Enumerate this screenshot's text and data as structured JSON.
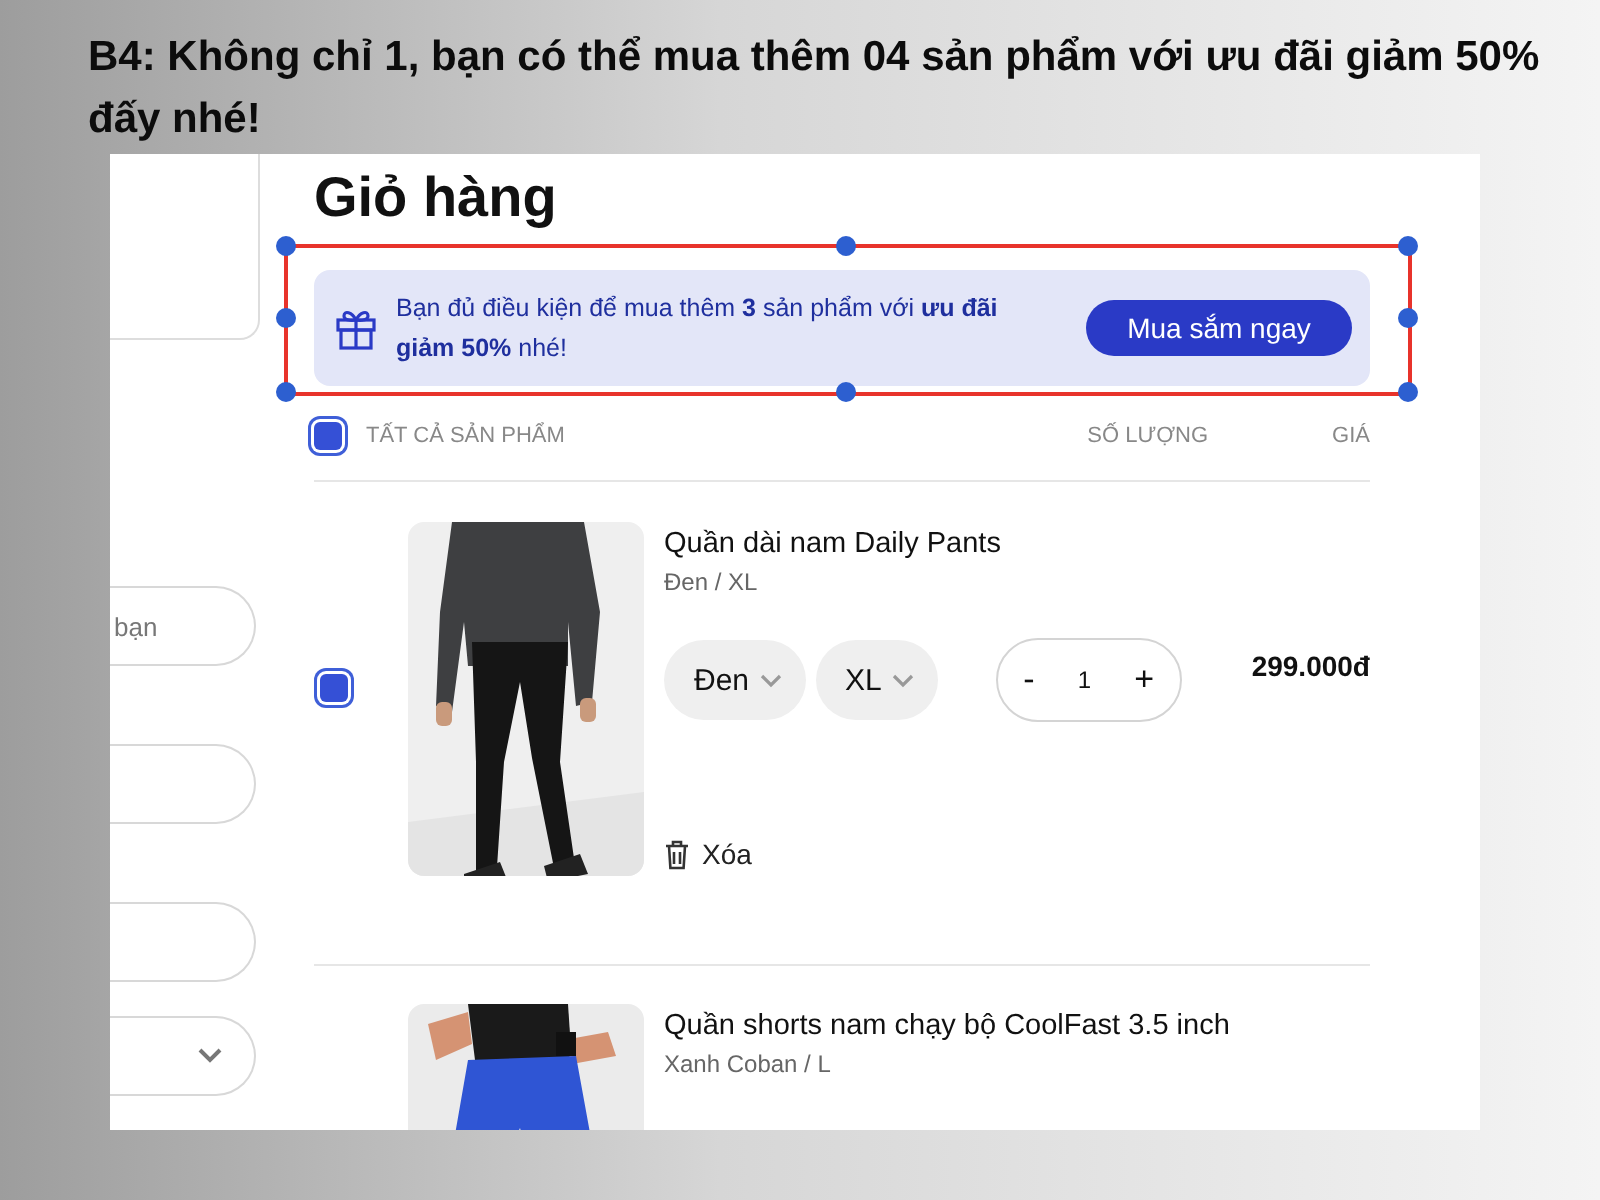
{
  "caption": "B4: Không chỉ 1, bạn có thể mua thêm 04 sản phẩm với ưu đãi giảm 50% đấy nhé!",
  "side_form": {
    "fields": [
      {
        "kind": "input",
        "placeholder": "bạn"
      },
      {
        "kind": "input"
      },
      {
        "kind": "input"
      },
      {
        "kind": "select"
      }
    ]
  },
  "cart": {
    "title": "Giỏ hàng",
    "promo": {
      "text": "Bạn đủ điều kiện để mua thêm **3** sản phẩm với **ưu đãi giảm 50%** nhé!",
      "button": "Mua sắm ngay",
      "highlighted": true
    },
    "select_all": {
      "label": "TẤT CẢ SẢN PHẨM",
      "checked": true
    },
    "columns": [
      "SỐ LƯỢNG",
      "GIÁ"
    ],
    "items": [
      {
        "name": "Quần dài nam Daily Pants",
        "variant": "Đen / XL",
        "checked": true,
        "options": [
          "Đen",
          "XL"
        ],
        "minus": "-",
        "quantity": "1",
        "plus": "+",
        "price": "299.000đ",
        "remove": "Xóa"
      },
      {
        "name": "Quần shorts nam chạy bộ CoolFast 3.5 inch",
        "variant": "Xanh Coban / L"
      }
    ]
  }
}
